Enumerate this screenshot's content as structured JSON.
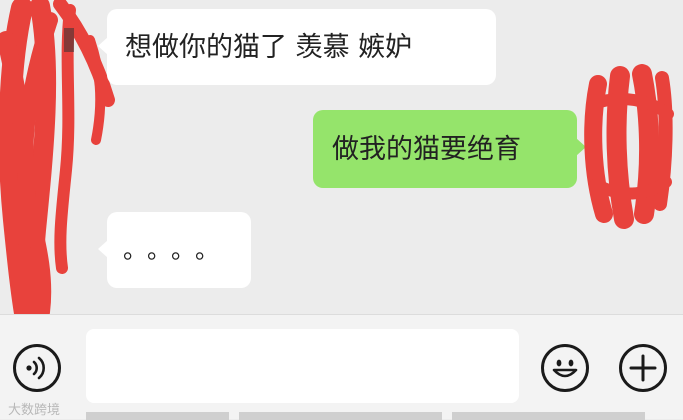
{
  "messages": [
    {
      "direction": "incoming",
      "text": "想做你的猫了  羡慕 嫉妒"
    },
    {
      "direction": "outgoing",
      "text": "做我的猫要绝育"
    },
    {
      "direction": "incoming",
      "text": "。。。。"
    }
  ],
  "input_bar": {
    "message_value": "",
    "icons": [
      "voice-icon",
      "emoji-icon",
      "plus-icon"
    ]
  },
  "watermark": "大数跨境",
  "colors": {
    "chat_background": "#ececec",
    "incoming_bubble": "#ffffff",
    "outgoing_bubble": "#95e46b",
    "scribble": "#e8423c"
  }
}
